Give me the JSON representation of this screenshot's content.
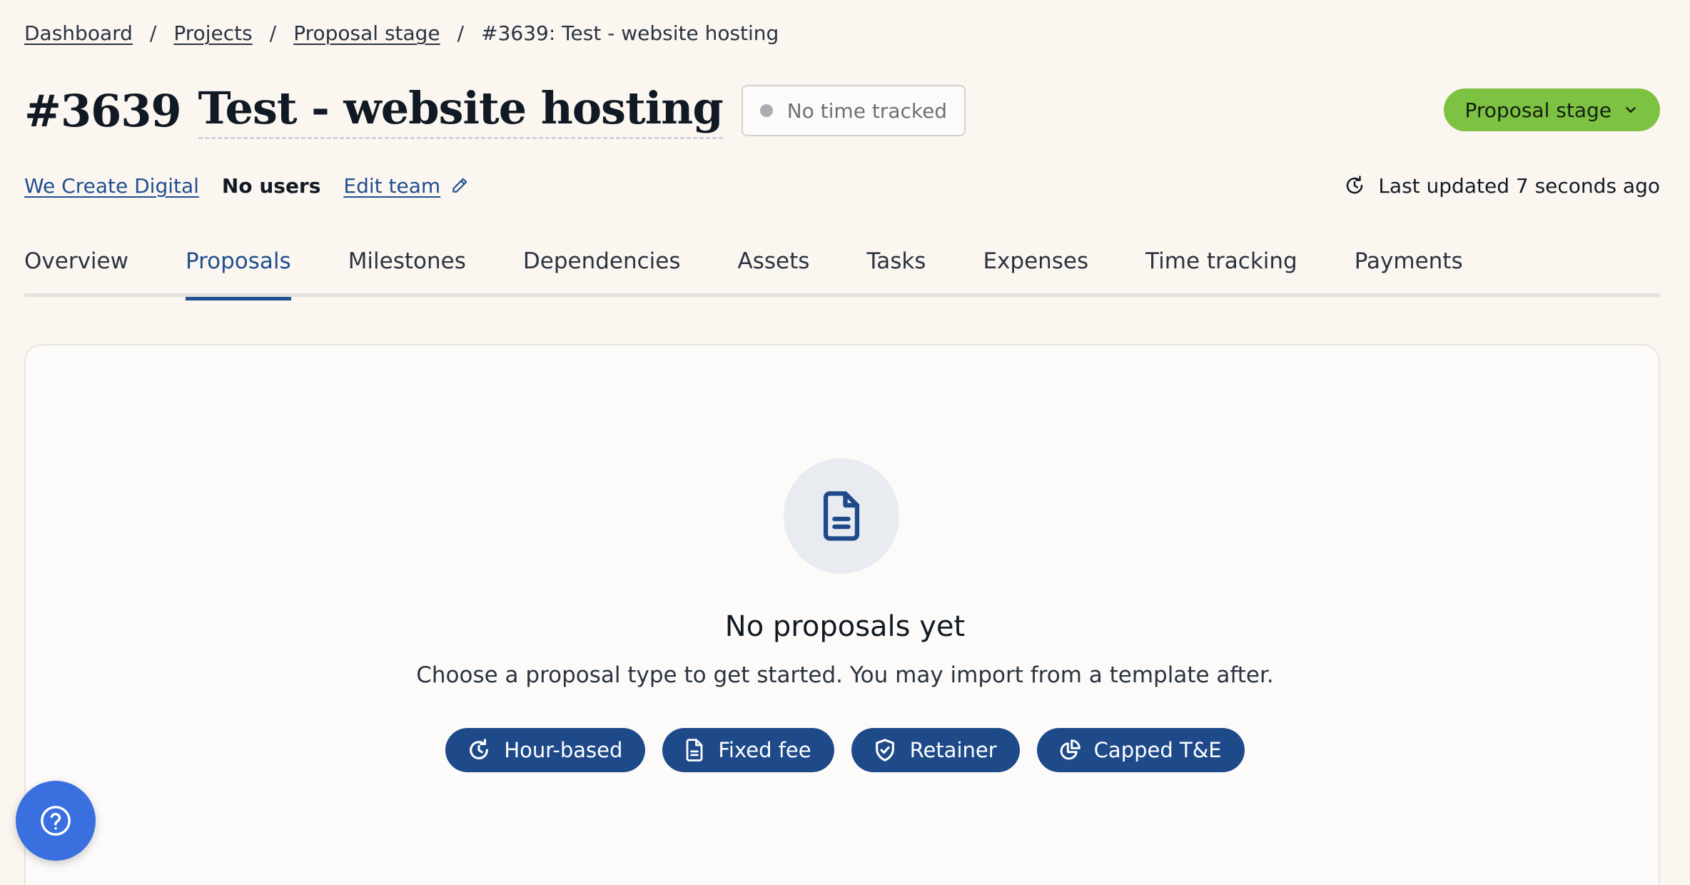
{
  "breadcrumb": {
    "items": [
      "Dashboard",
      "Projects",
      "Proposal stage"
    ],
    "current": "#3639: Test - website hosting",
    "separator": "/"
  },
  "project": {
    "number": "#3639",
    "title": "Test - website hosting",
    "time_badge": "No time tracked",
    "stage_label": "Proposal stage"
  },
  "meta": {
    "client": "We Create Digital",
    "users": "No users",
    "edit_team": "Edit team",
    "last_updated": "Last updated 7 seconds ago"
  },
  "tabs": [
    {
      "label": "Overview",
      "active": false
    },
    {
      "label": "Proposals",
      "active": true
    },
    {
      "label": "Milestones",
      "active": false
    },
    {
      "label": "Dependencies",
      "active": false
    },
    {
      "label": "Assets",
      "active": false
    },
    {
      "label": "Tasks",
      "active": false
    },
    {
      "label": "Expenses",
      "active": false
    },
    {
      "label": "Time tracking",
      "active": false
    },
    {
      "label": "Payments",
      "active": false
    }
  ],
  "empty_state": {
    "icon": "document-icon",
    "title": "No proposals yet",
    "subtitle": "Choose a proposal type to get started. You may import from a template after."
  },
  "proposal_types": [
    {
      "label": "Hour-based",
      "icon": "clock-icon"
    },
    {
      "label": "Fixed fee",
      "icon": "document-icon"
    },
    {
      "label": "Retainer",
      "icon": "shield-icon"
    },
    {
      "label": "Capped T&E",
      "icon": "pie-chart-icon"
    }
  ],
  "colors": {
    "background": "#fcf6f1",
    "accent": "#1f4f8f",
    "stage_green": "#7dc242",
    "button_blue": "#1f4a8a",
    "help_blue": "#3a6fe0"
  }
}
